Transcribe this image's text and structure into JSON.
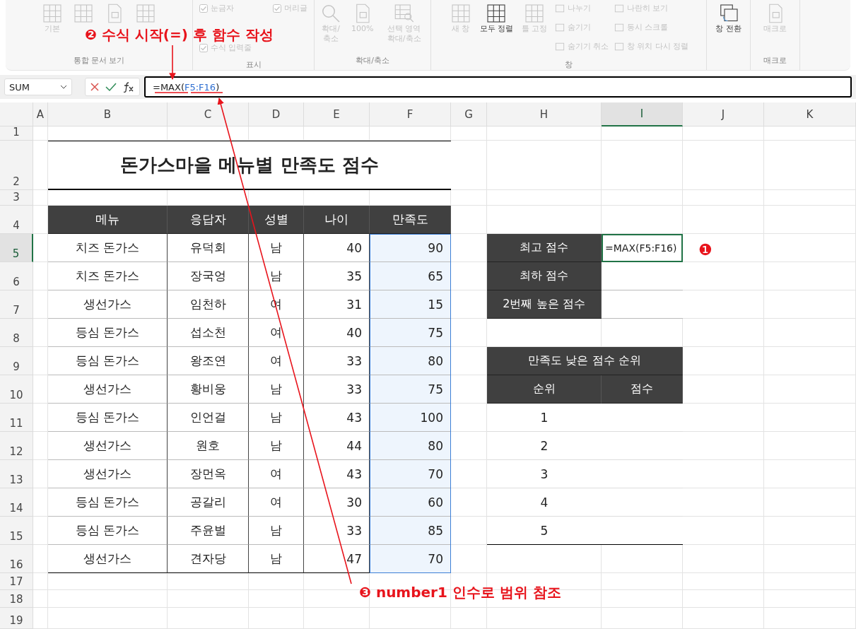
{
  "ribbon": {
    "groups": [
      {
        "label": "통합 문서 보기",
        "items": [
          {
            "kind": "big",
            "label": "기본",
            "disabled": true
          },
          {
            "kind": "big",
            "disabled": true
          },
          {
            "kind": "big",
            "disabled": true
          },
          {
            "kind": "big",
            "disabled": true
          }
        ]
      },
      {
        "label": "표시",
        "items": [
          {
            "kind": "check",
            "label": "눈금자",
            "checked": true,
            "disabled": true
          },
          {
            "kind": "check",
            "label": "머리글",
            "checked": true,
            "disabled": true
          },
          {
            "kind": "check",
            "label": "수식 입력줄",
            "checked": true,
            "disabled": true
          }
        ]
      },
      {
        "label": "확대/축소",
        "items": [
          {
            "kind": "big",
            "label": "확대/축소",
            "disabled": true
          },
          {
            "kind": "big",
            "label": "100%",
            "disabled": true
          },
          {
            "kind": "big",
            "label": "선택 영역 확대/축소",
            "disabled": true
          }
        ]
      },
      {
        "label": "창",
        "items": [
          {
            "kind": "big",
            "label": "새 창",
            "disabled": true
          },
          {
            "kind": "big",
            "label": "모두 정렬",
            "disabled": false
          },
          {
            "kind": "big",
            "label": "틀 고정",
            "disabled": true
          },
          {
            "kind": "small",
            "label": "나누기",
            "disabled": true
          },
          {
            "kind": "small",
            "label": "숨기기",
            "disabled": true
          },
          {
            "kind": "small",
            "label": "숨기기 취소",
            "disabled": true
          },
          {
            "kind": "small",
            "label": "나란히 보기",
            "disabled": true
          },
          {
            "kind": "small",
            "label": "동시 스크롤",
            "disabled": true
          },
          {
            "kind": "small",
            "label": "창 위치 다시 정렬",
            "disabled": true
          }
        ]
      },
      {
        "items": [
          {
            "kind": "big",
            "label": "창 전환",
            "disabled": false
          }
        ]
      },
      {
        "label": "매크로",
        "items": [
          {
            "kind": "big",
            "label": "매크로",
            "disabled": true
          }
        ]
      }
    ]
  },
  "formula_bar": {
    "name_box": "SUM",
    "parts": [
      {
        "kind": "plain",
        "text": "=MAX("
      },
      {
        "kind": "ref",
        "text": "F5:F16"
      },
      {
        "kind": "plain",
        "text": ")"
      }
    ]
  },
  "sheet": {
    "columns": [
      {
        "label": "A",
        "selected": false
      },
      {
        "label": "B",
        "selected": false
      },
      {
        "label": "C",
        "selected": false
      },
      {
        "label": "D",
        "selected": false
      },
      {
        "label": "E",
        "selected": false
      },
      {
        "label": "F",
        "selected": false
      },
      {
        "label": "G",
        "selected": false
      },
      {
        "label": "H",
        "selected": false
      },
      {
        "label": "I",
        "selected": true
      },
      {
        "label": "J",
        "selected": false
      },
      {
        "label": "K",
        "selected": false
      }
    ],
    "rows": [
      {
        "label": "1",
        "selected": false
      },
      {
        "label": "2",
        "selected": false
      },
      {
        "label": "3",
        "selected": false
      },
      {
        "label": "4",
        "selected": false
      },
      {
        "label": "5",
        "selected": true
      },
      {
        "label": "6",
        "selected": false
      },
      {
        "label": "7",
        "selected": false
      },
      {
        "label": "8",
        "selected": false
      },
      {
        "label": "9",
        "selected": false
      },
      {
        "label": "10",
        "selected": false
      },
      {
        "label": "11",
        "selected": false
      },
      {
        "label": "12",
        "selected": false
      },
      {
        "label": "13",
        "selected": false
      },
      {
        "label": "14",
        "selected": false
      },
      {
        "label": "15",
        "selected": false
      },
      {
        "label": "16",
        "selected": false
      },
      {
        "label": "17",
        "selected": false
      },
      {
        "label": "18",
        "selected": false
      },
      {
        "label": "19",
        "selected": false
      }
    ],
    "title": "돈가스마을 메뉴별 만족도 점수",
    "table": {
      "columns": [
        {
          "label": "메뉴",
          "kind": "text",
          "highlighted": false
        },
        {
          "label": "응답자",
          "kind": "text",
          "highlighted": false
        },
        {
          "label": "성별",
          "kind": "text",
          "highlighted": false
        },
        {
          "label": "나이",
          "kind": "number",
          "highlighted": false
        },
        {
          "label": "만족도",
          "kind": "number",
          "highlighted": true
        }
      ],
      "rows": [
        [
          "치즈 돈가스",
          "유덕회",
          "남",
          "40",
          "90"
        ],
        [
          "치즈 돈가스",
          "장국엉",
          "남",
          "35",
          "65"
        ],
        [
          "생선가스",
          "임천하",
          "여",
          "31",
          "15"
        ],
        [
          "등심 돈가스",
          "섭소천",
          "여",
          "40",
          "75"
        ],
        [
          "등심 돈가스",
          "왕조연",
          "여",
          "33",
          "80"
        ],
        [
          "생선가스",
          "황비웅",
          "남",
          "33",
          "75"
        ],
        [
          "등심 돈가스",
          "인언걸",
          "남",
          "43",
          "100"
        ],
        [
          "생선가스",
          "원호",
          "남",
          "44",
          "80"
        ],
        [
          "생선가스",
          "장먼옥",
          "여",
          "43",
          "70"
        ],
        [
          "등심 돈가스",
          "공갈리",
          "여",
          "30",
          "60"
        ],
        [
          "등심 돈가스",
          "주윤벌",
          "남",
          "33",
          "85"
        ],
        [
          "생선가스",
          "견자당",
          "남",
          "47",
          "70"
        ]
      ]
    },
    "summary": [
      {
        "label": "최고 점수",
        "value": "=MAX(F5:F16)",
        "selected": true
      },
      {
        "label": "최하 점수",
        "selected": false
      },
      {
        "label": "2번째 높은 점수",
        "selected": false
      }
    ],
    "rank": {
      "title": "만족도 낮은 점수 순위",
      "columns": [
        "순위",
        "점수"
      ],
      "rows": [
        "1",
        "2",
        "3",
        "4",
        "5"
      ]
    }
  },
  "annotations": [
    {
      "kind": "marker",
      "number": "❶"
    },
    {
      "kind": "callout",
      "number": "❷",
      "text": "수식 시작(=) 후 함수 작성"
    },
    {
      "kind": "callout",
      "number": "❸",
      "text": "number1 인수로 범위 참조"
    }
  ]
}
